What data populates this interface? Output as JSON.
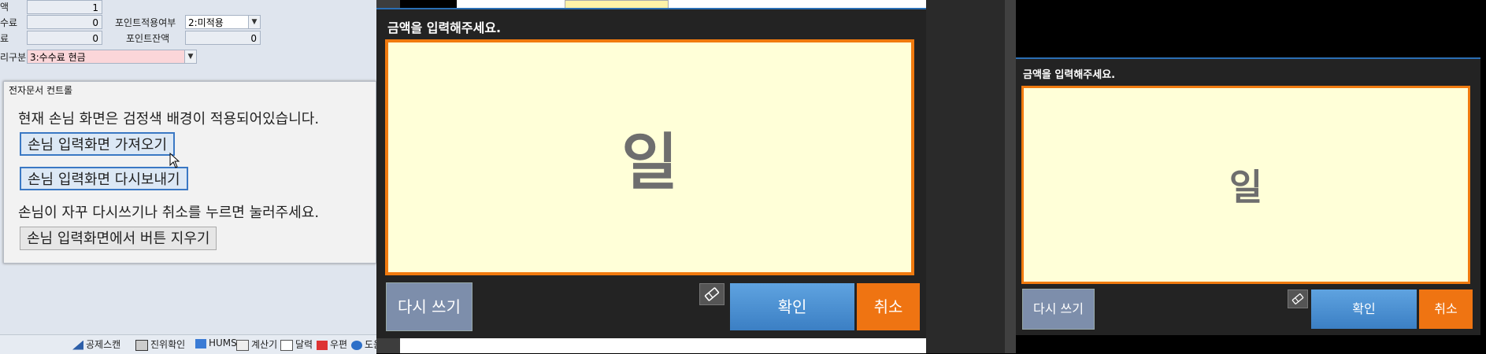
{
  "left_form": {
    "row1_label": "액",
    "row1_value": "1",
    "row2_label": "수료",
    "row2_value": "0",
    "row2_label2": "포인트적용여부",
    "row2_select": "2:미적용",
    "row3_label": "료",
    "row3_value": "0",
    "row3_label2": "포인트잔액",
    "row3_value2": "0",
    "row4_label": "리구분",
    "row4_select": "3:수수료 현금"
  },
  "dialog": {
    "title": "전자문서 컨트롤",
    "notice": "현재 손님 화면은 검정색 배경이 적용되어있습니다.",
    "fetch_button": "손님 입력화면 가져오기",
    "resend_button": "손님 입력화면 다시보내기",
    "hint": "손님이 자꾸 다시쓰기나 취소를 누르면 눌러주세요.",
    "clear_button": "손님 입력화면에서 버튼 지우기"
  },
  "status_bar": {
    "items": [
      "공제스캔",
      "진위확인",
      "HUMS",
      "계산기",
      "달력",
      "우편",
      "도움말"
    ]
  },
  "panel_main": {
    "title": "금액을 입력해주세요.",
    "handwriting": "일",
    "rewrite": "다시 쓰기",
    "confirm": "확인",
    "cancel": "취소"
  },
  "panel_mirror": {
    "title": "금액을 입력해주세요.",
    "handwriting": "일",
    "rewrite": "다시 쓰기",
    "confirm": "확인",
    "cancel": "취소"
  },
  "icons": {
    "eraser": "eraser-icon",
    "cursor": "mouse-cursor"
  },
  "colors": {
    "pad_background": "#ffffd8",
    "pad_border": "#f07a0f",
    "confirm": "#4a90d6",
    "cancel": "#ef7412",
    "rewrite": "#7d8eab",
    "panel_background": "#232323"
  }
}
